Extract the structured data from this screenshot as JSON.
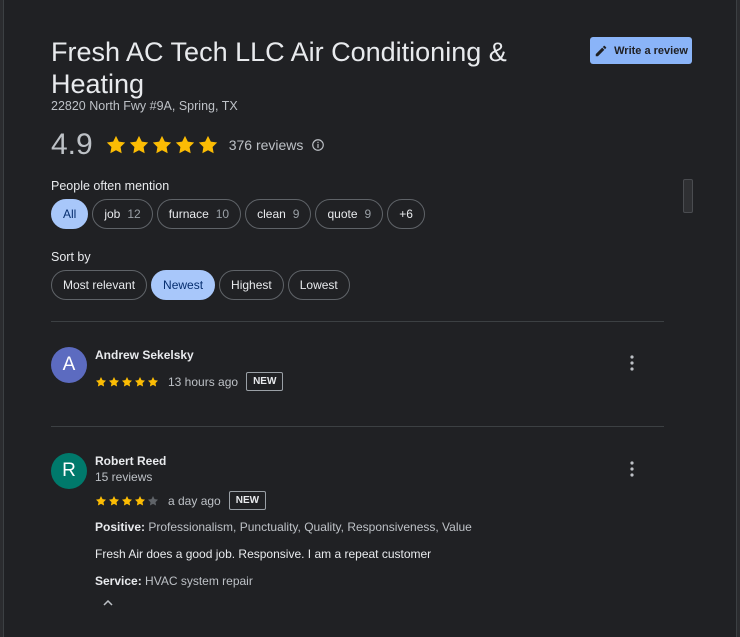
{
  "business": {
    "title": "Fresh AC Tech LLC Air Conditioning & Heating",
    "address": "22820 North Fwy #9A, Spring, TX",
    "rating": "4.9",
    "review_count": "376 reviews",
    "stars": 5
  },
  "actions": {
    "write_review": "Write a review"
  },
  "mentions": {
    "label": "People often mention",
    "chips": [
      {
        "label": "All",
        "count": ""
      },
      {
        "label": "job",
        "count": "12"
      },
      {
        "label": "furnace",
        "count": "10"
      },
      {
        "label": "clean",
        "count": "9"
      },
      {
        "label": "quote",
        "count": "9"
      },
      {
        "label": "+6",
        "count": ""
      }
    ]
  },
  "sort": {
    "label": "Sort by",
    "options": [
      "Most relevant",
      "Newest",
      "Highest",
      "Lowest"
    ],
    "selected": "Newest"
  },
  "reviews": [
    {
      "initial": "A",
      "name": "Andrew Sekelsky",
      "stars": 5,
      "time": "13 hours ago",
      "badge": "NEW",
      "avatar_color": "#5c6bc0"
    },
    {
      "initial": "R",
      "name": "Robert Reed",
      "sub": "15 reviews",
      "stars": 4,
      "time": "a day ago",
      "badge": "NEW",
      "avatar_color": "#00796b",
      "positive_label": "Positive:",
      "positive": "Professionalism, Punctuality, Quality, Responsiveness, Value",
      "text": "Fresh Air does a good job. Responsive. I am a repeat customer",
      "service_label": "Service:",
      "service": "HVAC system repair"
    }
  ],
  "colors": {
    "star": "#fbbc04",
    "star_empty": "#5f6368",
    "accent": "#8ab4f8"
  }
}
